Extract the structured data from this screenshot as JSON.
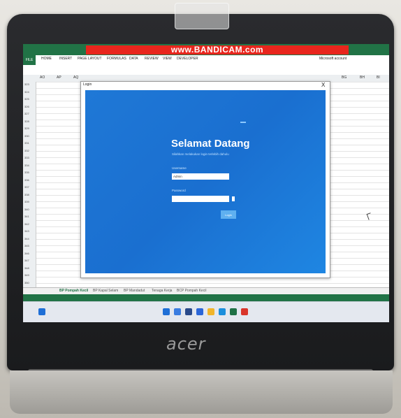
{
  "excel": {
    "watermark": "www.BANDICAM.com",
    "file_tab": "FILE",
    "tabs": [
      "HOME",
      "INSERT",
      "PAGE LAYOUT",
      "FORMULAS",
      "DATA",
      "REVIEW",
      "VIEW",
      "DEVELOPER"
    ],
    "account": "Microsoft account",
    "columns": [
      "AO",
      "AP",
      "AQ",
      "BG",
      "BH",
      "BI"
    ],
    "rows": [
      "323",
      "324",
      "325",
      "326",
      "327",
      "328",
      "329",
      "330",
      "331",
      "332",
      "333",
      "334",
      "335",
      "336",
      "337",
      "338",
      "339",
      "340",
      "341",
      "342",
      "343",
      "344",
      "345",
      "346",
      "347",
      "348",
      "349",
      "350"
    ],
    "sheets": [
      "BP Pompah Kecil",
      "BP Kapal Selam",
      "BP Mandadut",
      "Tenaga Kerja",
      "BCP Pompah Kecil"
    ]
  },
  "login": {
    "window_title": "Login",
    "close": "X",
    "heading": "Selamat Datang",
    "subtitle": "Silahkan melakukan login terlebih dahulu",
    "username_label": "Username",
    "username_value": "Admin",
    "password_label": "Password",
    "button_label": "Login"
  },
  "taskbar": {
    "clock_time": "",
    "icons": [
      "start-icon",
      "search-icon",
      "taskview-icon",
      "explorer-icon",
      "edge-icon",
      "excel-icon",
      "chrome-icon",
      "app-icon"
    ]
  },
  "laptop": {
    "brand": "acer"
  }
}
